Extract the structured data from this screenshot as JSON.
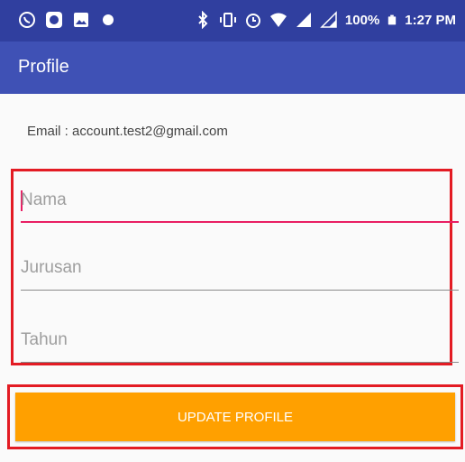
{
  "status_bar": {
    "left_icons": [
      "whatsapp-icon",
      "app-icon",
      "gallery-icon",
      "notification-dot-icon"
    ],
    "right_icons": [
      "bluetooth-icon",
      "vibrate-icon",
      "alarm-icon",
      "wifi-icon",
      "signal-icon",
      "signal-weak-icon",
      "battery-icon"
    ],
    "battery": "100%",
    "time": "1:27 PM"
  },
  "app_bar": {
    "title": "Profile"
  },
  "profile": {
    "email_line": "Email : account.test2@gmail.com"
  },
  "form": {
    "nama_placeholder": "Nama",
    "jurusan_placeholder": "Jurusan",
    "tahun_placeholder": "Tahun"
  },
  "actions": {
    "update_label": "UPDATE PROFILE"
  },
  "colors": {
    "status_bar": "#303f9f",
    "app_bar": "#3f51b5",
    "accent": "#e91e63",
    "button": "#ffa000",
    "highlight_border": "#e31b23"
  }
}
